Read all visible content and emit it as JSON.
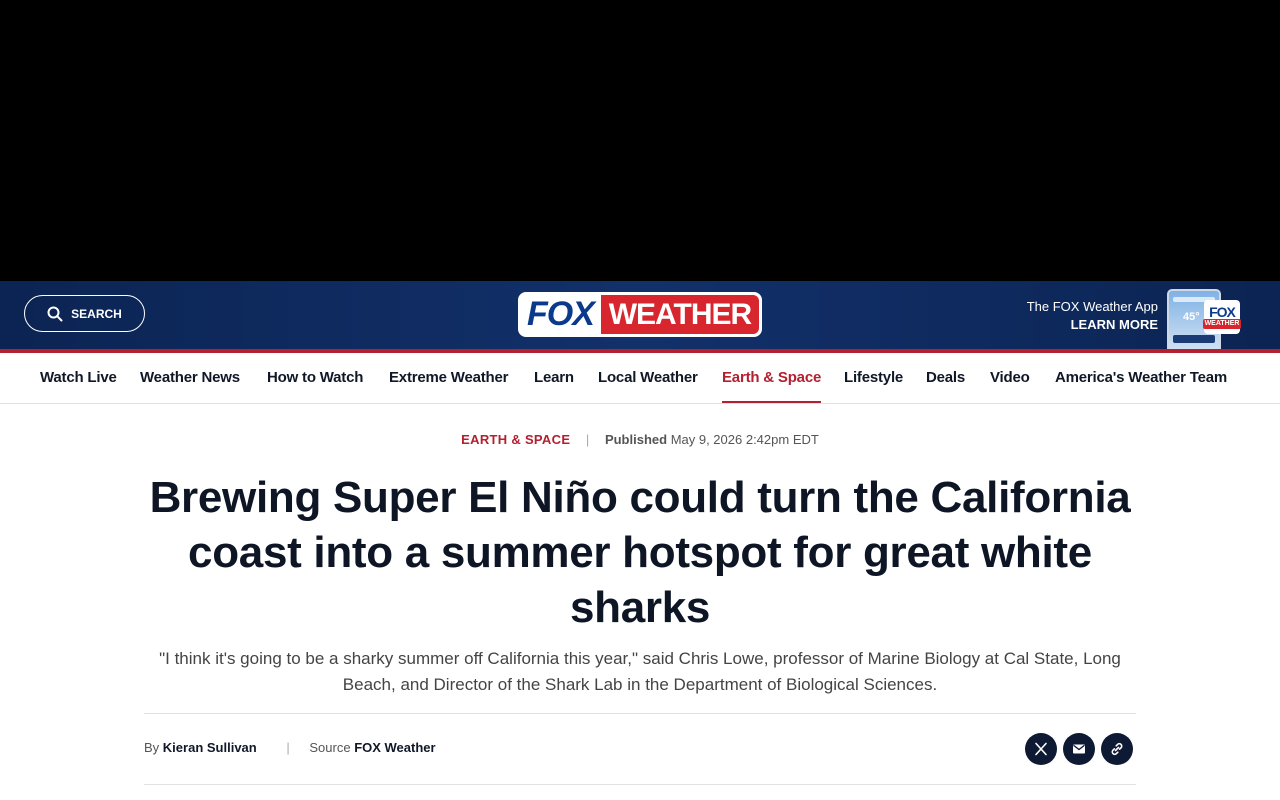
{
  "header": {
    "search_label": "SEARCH",
    "logo": {
      "fox": "FOX",
      "weather": "WEATHER"
    },
    "app_promo": {
      "line1": "The FOX Weather App",
      "line2": "LEARN MORE",
      "phone_temp": "45°"
    },
    "mini_logo": {
      "fox": "FOX",
      "weather": "WEATHER"
    }
  },
  "nav": {
    "items": [
      {
        "label": "Watch Live"
      },
      {
        "label": "Weather News"
      },
      {
        "label": "How to Watch"
      },
      {
        "label": "Extreme Weather"
      },
      {
        "label": "Learn"
      },
      {
        "label": "Local Weather"
      },
      {
        "label": "Earth & Space",
        "active": true
      },
      {
        "label": "Lifestyle"
      },
      {
        "label": "Deals"
      },
      {
        "label": "Video"
      },
      {
        "label": "America's Weather Team"
      }
    ]
  },
  "article": {
    "category": "EARTH & SPACE",
    "published_label": "Published",
    "published_date": "May 9, 2026 2:42pm EDT",
    "headline": "Brewing Super El Niño could turn the California coast into a summer hotspot for great white sharks",
    "dek": "\"I think it's going to be a sharky summer off California this year,\" said Chris Lowe, professor of Marine Biology at Cal State, Long Beach, and Director of the Shark Lab in the Department of Biological Sciences.",
    "by_label": "By",
    "author": "Kieran Sullivan",
    "source_label": "Source",
    "source": "FOX Weather"
  },
  "share": {
    "icons": [
      "x-icon",
      "email-icon",
      "link-icon"
    ]
  },
  "colors": {
    "navy": "#0b2453",
    "accent_red": "#b3202f",
    "text_dark": "#0e1525"
  }
}
